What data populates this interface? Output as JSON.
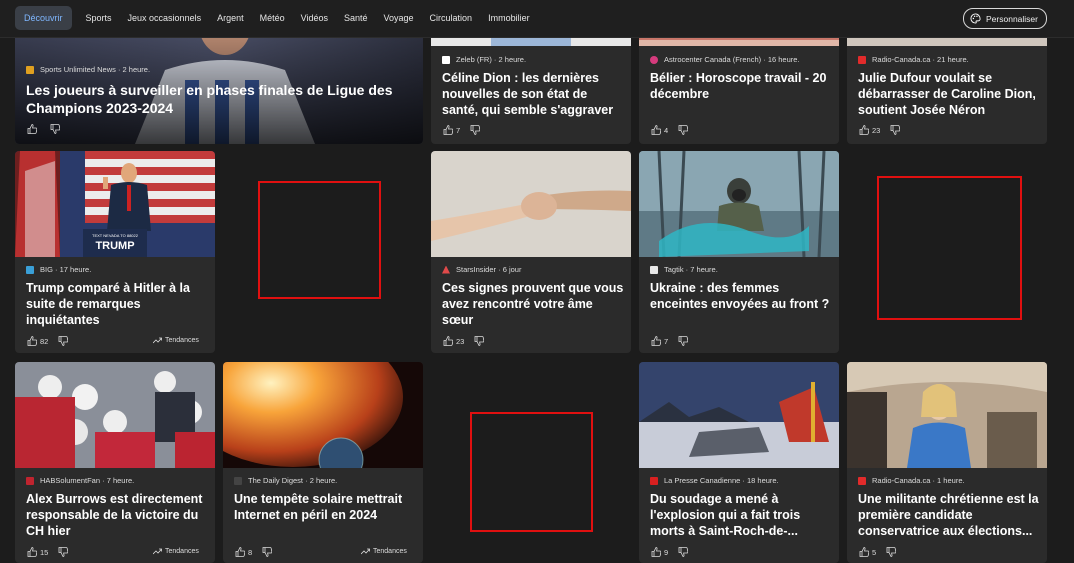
{
  "nav": {
    "items": [
      "Découvrir",
      "Sports",
      "Jeux occasionnels",
      "Argent",
      "Météo",
      "Vidéos",
      "Santé",
      "Voyage",
      "Circulation",
      "Immobilier"
    ],
    "customize_label": "Personnaliser"
  },
  "cards": [
    {
      "source": "Sports Unlimited News",
      "time": "2 heure.",
      "title": "Les joueurs à surveiller en phases finales de Ligue des Champions 2023-2024",
      "likes": ""
    },
    {
      "source": "Zeleb (FR)",
      "time": "2 heure.",
      "title": "Céline Dion : les dernières nouvelles de son état de santé, qui semble s'aggraver",
      "likes": "7"
    },
    {
      "source": "Astrocenter Canada (French)",
      "time": "16 heure.",
      "title": "Bélier : Horoscope travail - 20 décembre",
      "likes": "4"
    },
    {
      "source": "Radio-Canada.ca",
      "time": "21 heure.",
      "title": "Julie Dufour voulait se débarrasser de Caroline Dion, soutient Josée Néron",
      "likes": "23"
    },
    {
      "source": "BIG",
      "time": "17 heure.",
      "title": "Trump comparé à Hitler à la suite de remarques inquiétantes",
      "likes": "82",
      "trend": "Tendances",
      "sign_top": "TEXT NEVADA TO 88022",
      "sign_main": "TRUMP"
    },
    {
      "source": "StarsInsider",
      "time": "6 jour",
      "title": "Ces signes prouvent que vous avez rencontré votre âme sœur",
      "likes": "23"
    },
    {
      "source": "Tagtik",
      "time": "7 heure.",
      "title": "Ukraine : des femmes enceintes envoyées au front ?",
      "likes": "7"
    },
    {
      "source": "HABSolumentFan",
      "time": "7 heure.",
      "title": "Alex Burrows est directement responsable de la victoire du CH hier",
      "likes": "15",
      "trend": "Tendances"
    },
    {
      "source": "The Daily Digest",
      "time": "2 heure.",
      "title": "Une tempête solaire mettrait Internet en péril en 2024",
      "likes": "8",
      "trend": "Tendances"
    },
    {
      "source": "La Presse Canadienne",
      "time": "18 heure.",
      "title": "Du soudage a mené à l'explosion qui a fait trois morts à Saint-Roch-de-...",
      "likes": "9"
    },
    {
      "source": "Radio-Canada.ca",
      "time": "1 heure.",
      "title": "Une militante chrétienne est la première candidate conservatrice aux élections...",
      "likes": "5"
    }
  ]
}
